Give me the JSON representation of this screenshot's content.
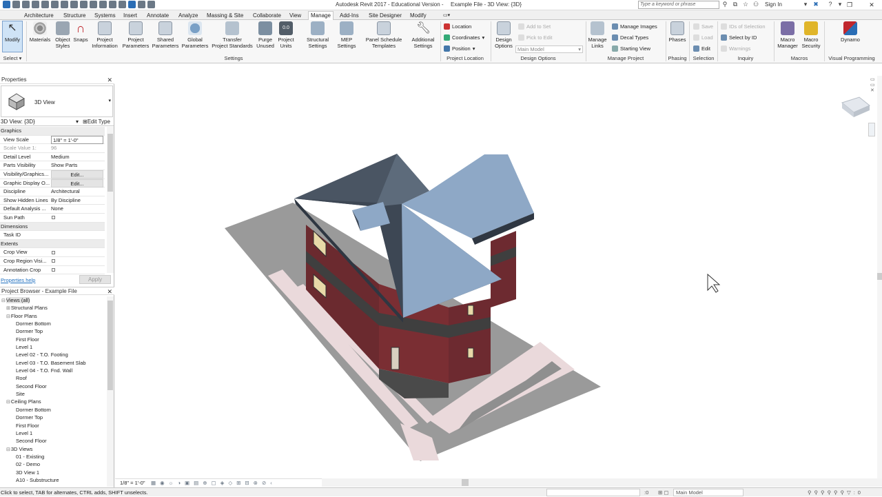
{
  "titlebar": {
    "app_title": "Autodesk Revit 2017 - Educational Version -",
    "file_title": "Example File - 3D View: {3D}",
    "search_placeholder": "Type a keyword or phrase",
    "sign_in": "Sign In"
  },
  "tabs": [
    "Architecture",
    "Structure",
    "Systems",
    "Insert",
    "Annotate",
    "Analyze",
    "Massing & Site",
    "Collaborate",
    "View",
    "Manage",
    "Add-Ins",
    "Site Designer",
    "Modify"
  ],
  "active_tab": "Manage",
  "ribbon": {
    "select": {
      "modify": "Modify",
      "panel": "Select"
    },
    "settings": {
      "buttons": [
        {
          "l1": "Materials",
          "l2": ""
        },
        {
          "l1": "Object",
          "l2": "Styles"
        },
        {
          "l1": "Snaps",
          "l2": ""
        },
        {
          "l1": "Project",
          "l2": "Information"
        },
        {
          "l1": "Project",
          "l2": "Parameters"
        },
        {
          "l1": "Shared",
          "l2": "Parameters"
        },
        {
          "l1": "Global",
          "l2": "Parameters"
        },
        {
          "l1": "Transfer",
          "l2": "Project Standards"
        },
        {
          "l1": "Purge",
          "l2": "Unused"
        },
        {
          "l1": "Project",
          "l2": "Units"
        },
        {
          "l1": "Structural",
          "l2": "Settings"
        },
        {
          "l1": "MEP",
          "l2": "Settings"
        },
        {
          "l1": "Panel Schedule",
          "l2": "Templates"
        },
        {
          "l1": "Additional",
          "l2": "Settings"
        }
      ],
      "panel": "Settings"
    },
    "project_location": {
      "location": "Location",
      "coordinates": "Coordinates",
      "position": "Position",
      "panel": "Project Location"
    },
    "design_options": {
      "btn1": "Design",
      "btn2": "Options",
      "add_to_set": "Add to Set",
      "pick_to_edit": "Pick to Edit",
      "main_model": "Main Model",
      "panel": "Design Options"
    },
    "manage_project": {
      "links1": "Manage",
      "links2": "Links",
      "manage_images": "Manage  Images",
      "decal_types": "Decal  Types",
      "starting_view": "Starting  View",
      "panel": "Manage Project"
    },
    "phasing": {
      "phases": "Phases",
      "panel": "Phasing"
    },
    "selection": {
      "save": "Save",
      "load": "Load",
      "edit": "Edit",
      "panel": "Selection"
    },
    "inquiry": {
      "ids": "IDs of  Selection",
      "select_by_id": "Select  by ID",
      "warnings": "Warnings",
      "panel": "Inquiry"
    },
    "macros": {
      "mm1": "Macro",
      "mm2": "Manager",
      "ms1": "Macro",
      "ms2": "Security",
      "panel": "Macros"
    },
    "visual_programming": {
      "dynamo": "Dynamo",
      "panel": "Visual Programming"
    }
  },
  "properties": {
    "header": "Properties",
    "type_name": "3D View",
    "selector": "3D View: {3D}",
    "edit_type": "Edit Type",
    "rows": [
      {
        "k": "Graphics",
        "v": "",
        "kind": "group"
      },
      {
        "k": "View Scale",
        "v": "1/8\" = 1'-0\"",
        "kind": "box"
      },
      {
        "k": "Scale Value    1:",
        "v": "96",
        "kind": "dim"
      },
      {
        "k": "Detail Level",
        "v": "Medium",
        "kind": "text"
      },
      {
        "k": "Parts Visibility",
        "v": "Show Parts",
        "kind": "text"
      },
      {
        "k": "Visibility/Graphics...",
        "v": "Edit...",
        "kind": "edit"
      },
      {
        "k": "Graphic Display O...",
        "v": "Edit...",
        "kind": "edit"
      },
      {
        "k": "Discipline",
        "v": "Architectural",
        "kind": "text"
      },
      {
        "k": "Show Hidden Lines",
        "v": "By Discipline",
        "kind": "text"
      },
      {
        "k": "Default Analysis ...",
        "v": "None",
        "kind": "text"
      },
      {
        "k": "Sun Path",
        "v": "",
        "kind": "check"
      },
      {
        "k": "Dimensions",
        "v": "",
        "kind": "group"
      },
      {
        "k": "Task ID",
        "v": "",
        "kind": "text"
      },
      {
        "k": "Extents",
        "v": "",
        "kind": "group"
      },
      {
        "k": "Crop View",
        "v": "",
        "kind": "check"
      },
      {
        "k": "Crop Region Visi...",
        "v": "",
        "kind": "check"
      },
      {
        "k": "Annotation Crop",
        "v": "",
        "kind": "check"
      }
    ],
    "help": "Properties help",
    "apply": "Apply"
  },
  "project_browser": {
    "header": "Project Browser - Example File",
    "items": [
      {
        "label": "Views (all)",
        "level": 0,
        "toggle": "⊟"
      },
      {
        "label": "Structural Plans",
        "level": 1,
        "toggle": "⊞"
      },
      {
        "label": "Floor Plans",
        "level": 1,
        "toggle": "⊟"
      },
      {
        "label": "Dormer Bottom",
        "level": 2,
        "toggle": ""
      },
      {
        "label": "Dormer Top",
        "level": 2,
        "toggle": ""
      },
      {
        "label": "First Floor",
        "level": 2,
        "toggle": ""
      },
      {
        "label": "Level 1",
        "level": 2,
        "toggle": ""
      },
      {
        "label": "Level 02 - T.O. Footing",
        "level": 2,
        "toggle": ""
      },
      {
        "label": "Level 03 - T.O. Basement Slab",
        "level": 2,
        "toggle": ""
      },
      {
        "label": "Level 04 - T.O. Fnd. Wall",
        "level": 2,
        "toggle": ""
      },
      {
        "label": "Roof",
        "level": 2,
        "toggle": ""
      },
      {
        "label": "Second Floor",
        "level": 2,
        "toggle": ""
      },
      {
        "label": "Site",
        "level": 2,
        "toggle": ""
      },
      {
        "label": "Ceiling Plans",
        "level": 1,
        "toggle": "⊟"
      },
      {
        "label": "Dormer Bottom",
        "level": 2,
        "toggle": ""
      },
      {
        "label": "Dormer Top",
        "level": 2,
        "toggle": ""
      },
      {
        "label": "First Floor",
        "level": 2,
        "toggle": ""
      },
      {
        "label": "Level 1",
        "level": 2,
        "toggle": ""
      },
      {
        "label": "Second Floor",
        "level": 2,
        "toggle": ""
      },
      {
        "label": "3D Views",
        "level": 1,
        "toggle": "⊟"
      },
      {
        "label": "01 - Existing",
        "level": 2,
        "toggle": ""
      },
      {
        "label": "02 - Demo",
        "level": 2,
        "toggle": ""
      },
      {
        "label": "3D View 1",
        "level": 2,
        "toggle": ""
      },
      {
        "label": "A10 - Substructure",
        "level": 2,
        "toggle": ""
      }
    ]
  },
  "view_control_bar": {
    "scale": "1/8\" = 1'-0\""
  },
  "status_bar": {
    "message": "Click to select, TAB for alternates, CTRL adds, SHIFT unselects.",
    "zero": ":0",
    "model": "Main Model"
  }
}
